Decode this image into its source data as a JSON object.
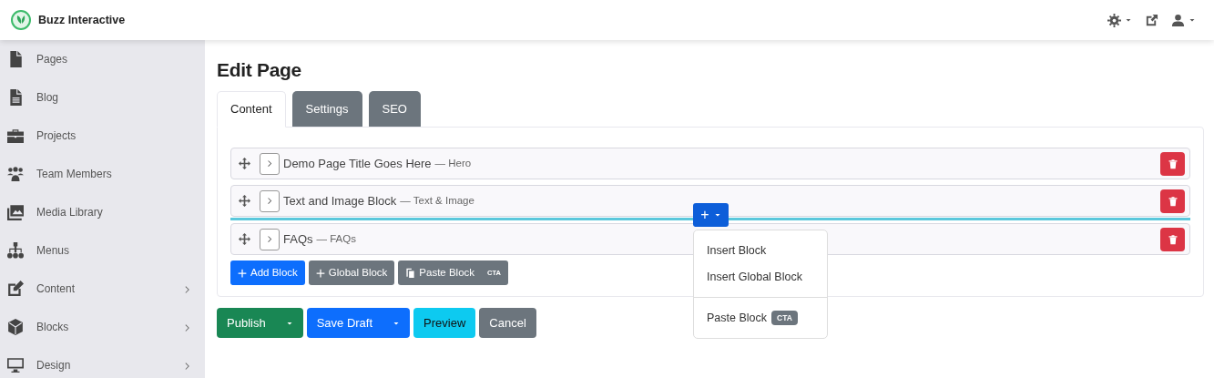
{
  "brand": {
    "name": "Buzz Interactive"
  },
  "header_icons": [
    {
      "kind": "gear",
      "caret": true
    },
    {
      "kind": "external",
      "caret": false
    },
    {
      "kind": "user",
      "caret": true
    }
  ],
  "sidebar": {
    "items": [
      {
        "label": "Pages",
        "kind": "file",
        "has_submenu": false
      },
      {
        "label": "Blog",
        "kind": "doc",
        "has_submenu": false
      },
      {
        "label": "Projects",
        "kind": "briefcase",
        "has_submenu": false
      },
      {
        "label": "Team Members",
        "kind": "people",
        "has_submenu": false
      },
      {
        "label": "Media Library",
        "kind": "images",
        "has_submenu": false
      },
      {
        "label": "Menus",
        "kind": "sitemap",
        "has_submenu": false
      },
      {
        "label": "Content",
        "kind": "edit",
        "has_submenu": true
      },
      {
        "label": "Blocks",
        "kind": "cube",
        "has_submenu": true
      },
      {
        "label": "Design",
        "kind": "monitor",
        "has_submenu": true
      }
    ]
  },
  "page_title": "Edit Page",
  "tabs": [
    {
      "label": "Content",
      "selected": true
    },
    {
      "label": "Settings",
      "selected": false
    },
    {
      "label": "SEO",
      "selected": false
    }
  ],
  "blocks": [
    {
      "title": "Demo Page Title Goes Here",
      "type": "— Hero",
      "insert_marker_below": false
    },
    {
      "title": "Text and Image Block",
      "type": "— Text & Image",
      "insert_marker_below": true
    },
    {
      "title": "FAQs",
      "type": "— FAQs",
      "insert_marker_below": false
    }
  ],
  "insert_button": {
    "label": "+"
  },
  "block_actions": [
    {
      "kind": "add",
      "label": "Add Block"
    },
    {
      "kind": "global",
      "label": "Global Block"
    },
    {
      "kind": "paste",
      "label": "Paste Block",
      "badge": "CTA"
    }
  ],
  "insert_menu": {
    "open": true,
    "items": [
      {
        "label": "Insert Block",
        "divider_before": false
      },
      {
        "label": "Insert Global Block",
        "divider_before": false
      },
      {
        "label": "Paste Block",
        "badge": "CTA",
        "divider_before": true
      }
    ]
  },
  "footer_buttons": [
    {
      "label": "Publish",
      "kind": "publish",
      "split": true
    },
    {
      "label": "Save Draft",
      "kind": "save",
      "split": true
    },
    {
      "label": "Preview",
      "kind": "preview",
      "split": false
    },
    {
      "label": "Cancel",
      "kind": "cancel",
      "split": false
    }
  ]
}
